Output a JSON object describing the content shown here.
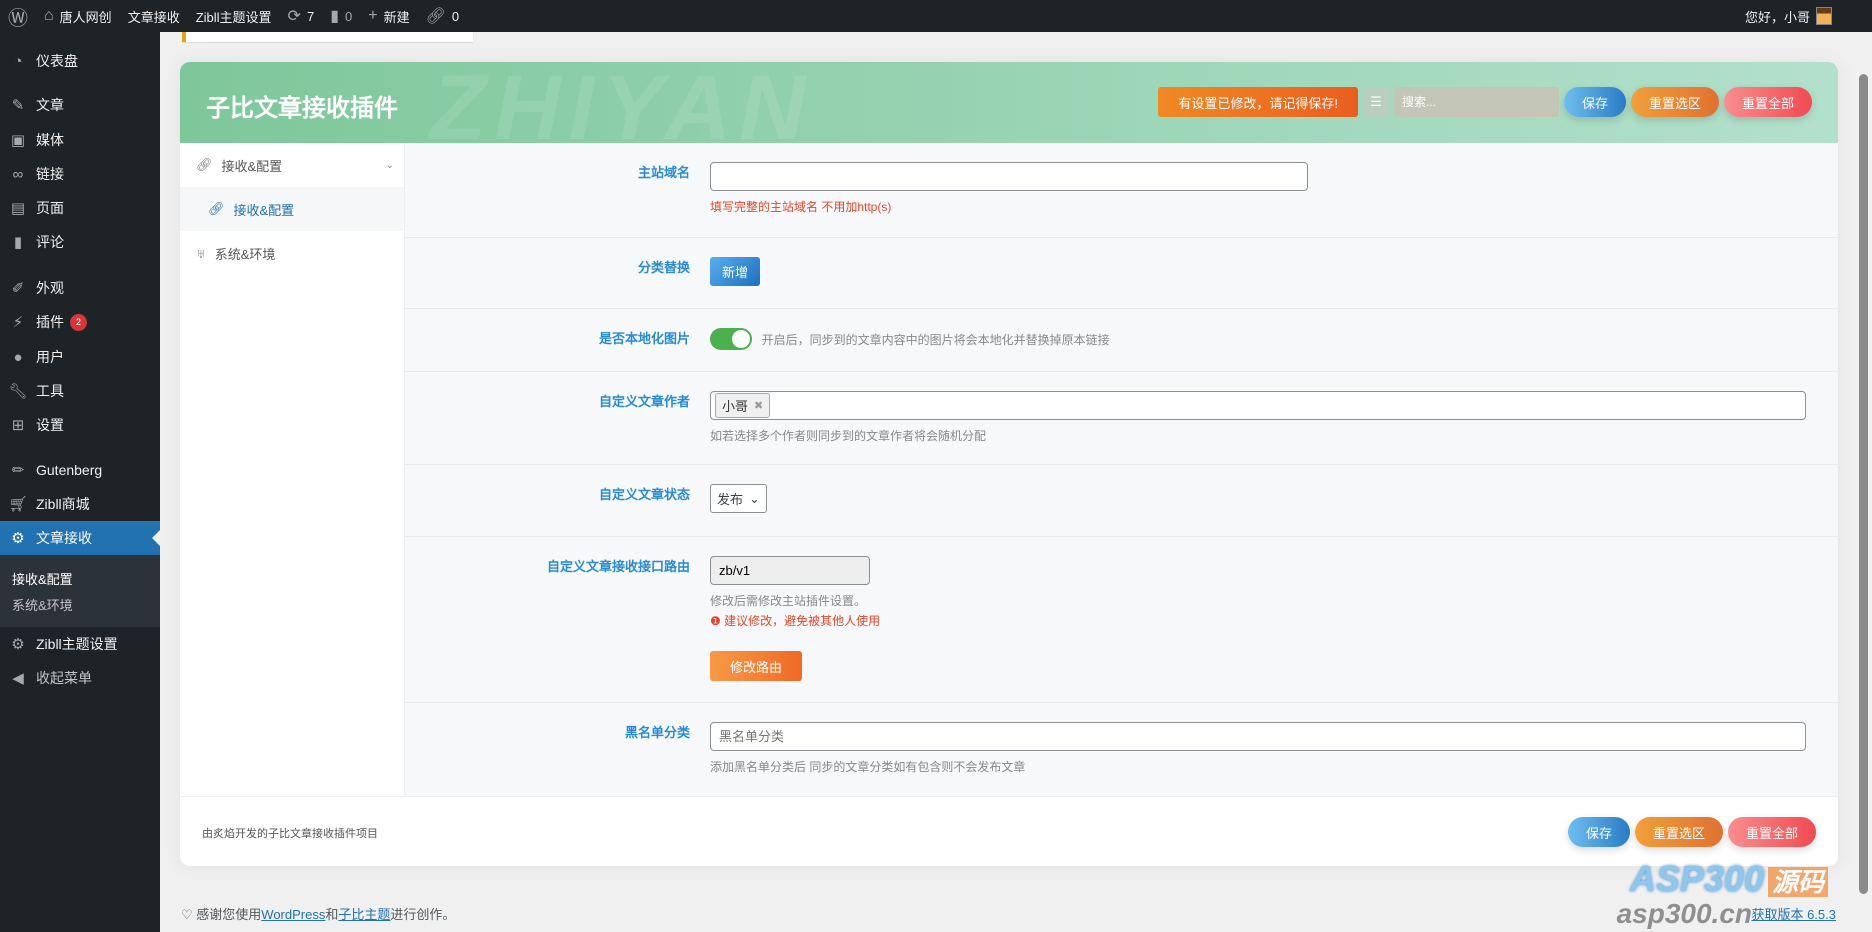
{
  "adminbar": {
    "site": "唐人网创",
    "items": [
      "文章接收",
      "Zibll主题设置"
    ],
    "updates": "7",
    "comments": "0",
    "new": "新建",
    "links": "0",
    "greeting": "您好，小哥"
  },
  "sidebar": {
    "items": [
      "仪表盘",
      "文章",
      "媒体",
      "链接",
      "页面",
      "评论",
      "外观",
      "插件",
      "用户",
      "工具",
      "设置",
      "Gutenberg",
      "Zibll商城",
      "文章接收",
      "Zibll主题设置",
      "收起菜单"
    ],
    "plugins_badge": "2",
    "submenu": [
      "接收&配置",
      "系统&环境"
    ]
  },
  "panel": {
    "title": "子比文章接收插件",
    "watermark": "ZHIYAN",
    "warning": "有设置已修改，请记得保存!",
    "search_placeholder": "搜索...",
    "save": "保存",
    "reset_section": "重置选区",
    "reset_all": "重置全部",
    "nav": {
      "group": "接收&配置",
      "active": "接收&配置",
      "other": "系统&环境"
    },
    "fields": {
      "domain": {
        "label": "主站域名",
        "value": "",
        "hint": "填写完整的主站域名 不用加http(s)"
      },
      "category": {
        "label": "分类替换",
        "button": "新增"
      },
      "localize": {
        "label": "是否本地化图片",
        "on": true,
        "desc": "开启后，同步到的文章内容中的图片将会本地化并替换掉原本链接"
      },
      "author": {
        "label": "自定义文章作者",
        "tags": [
          "小哥"
        ],
        "desc": "如若选择多个作者则同步到的文章作者将会随机分配"
      },
      "status": {
        "label": "自定义文章状态",
        "value": "发布"
      },
      "route": {
        "label": "自定义文章接收接口路由",
        "value": "zb/v1",
        "desc": "修改后需修改主站插件设置。",
        "warn": "建议修改，避免被其他人使用",
        "button": "修改路由"
      },
      "blacklist": {
        "label": "黑名单分类",
        "placeholder": "黑名单分类",
        "desc": "添加黑名单分类后 同步的文章分类如有包含则不会发布文章"
      }
    },
    "footer_text": "由炙焰开发的子比文章接收插件项目"
  },
  "wpfooter": {
    "pre": "感谢您使用",
    "wp": "WordPress",
    "and": "和",
    "theme": "子比主题",
    "post": "进行创作。",
    "version": "获取版本 6.5.3"
  },
  "watermark": {
    "brand": "ASP300",
    "tag": "源码",
    "url": "asp300.cn"
  },
  "colors": {
    "accent": "#2271b1",
    "green": "#7ec79b"
  }
}
